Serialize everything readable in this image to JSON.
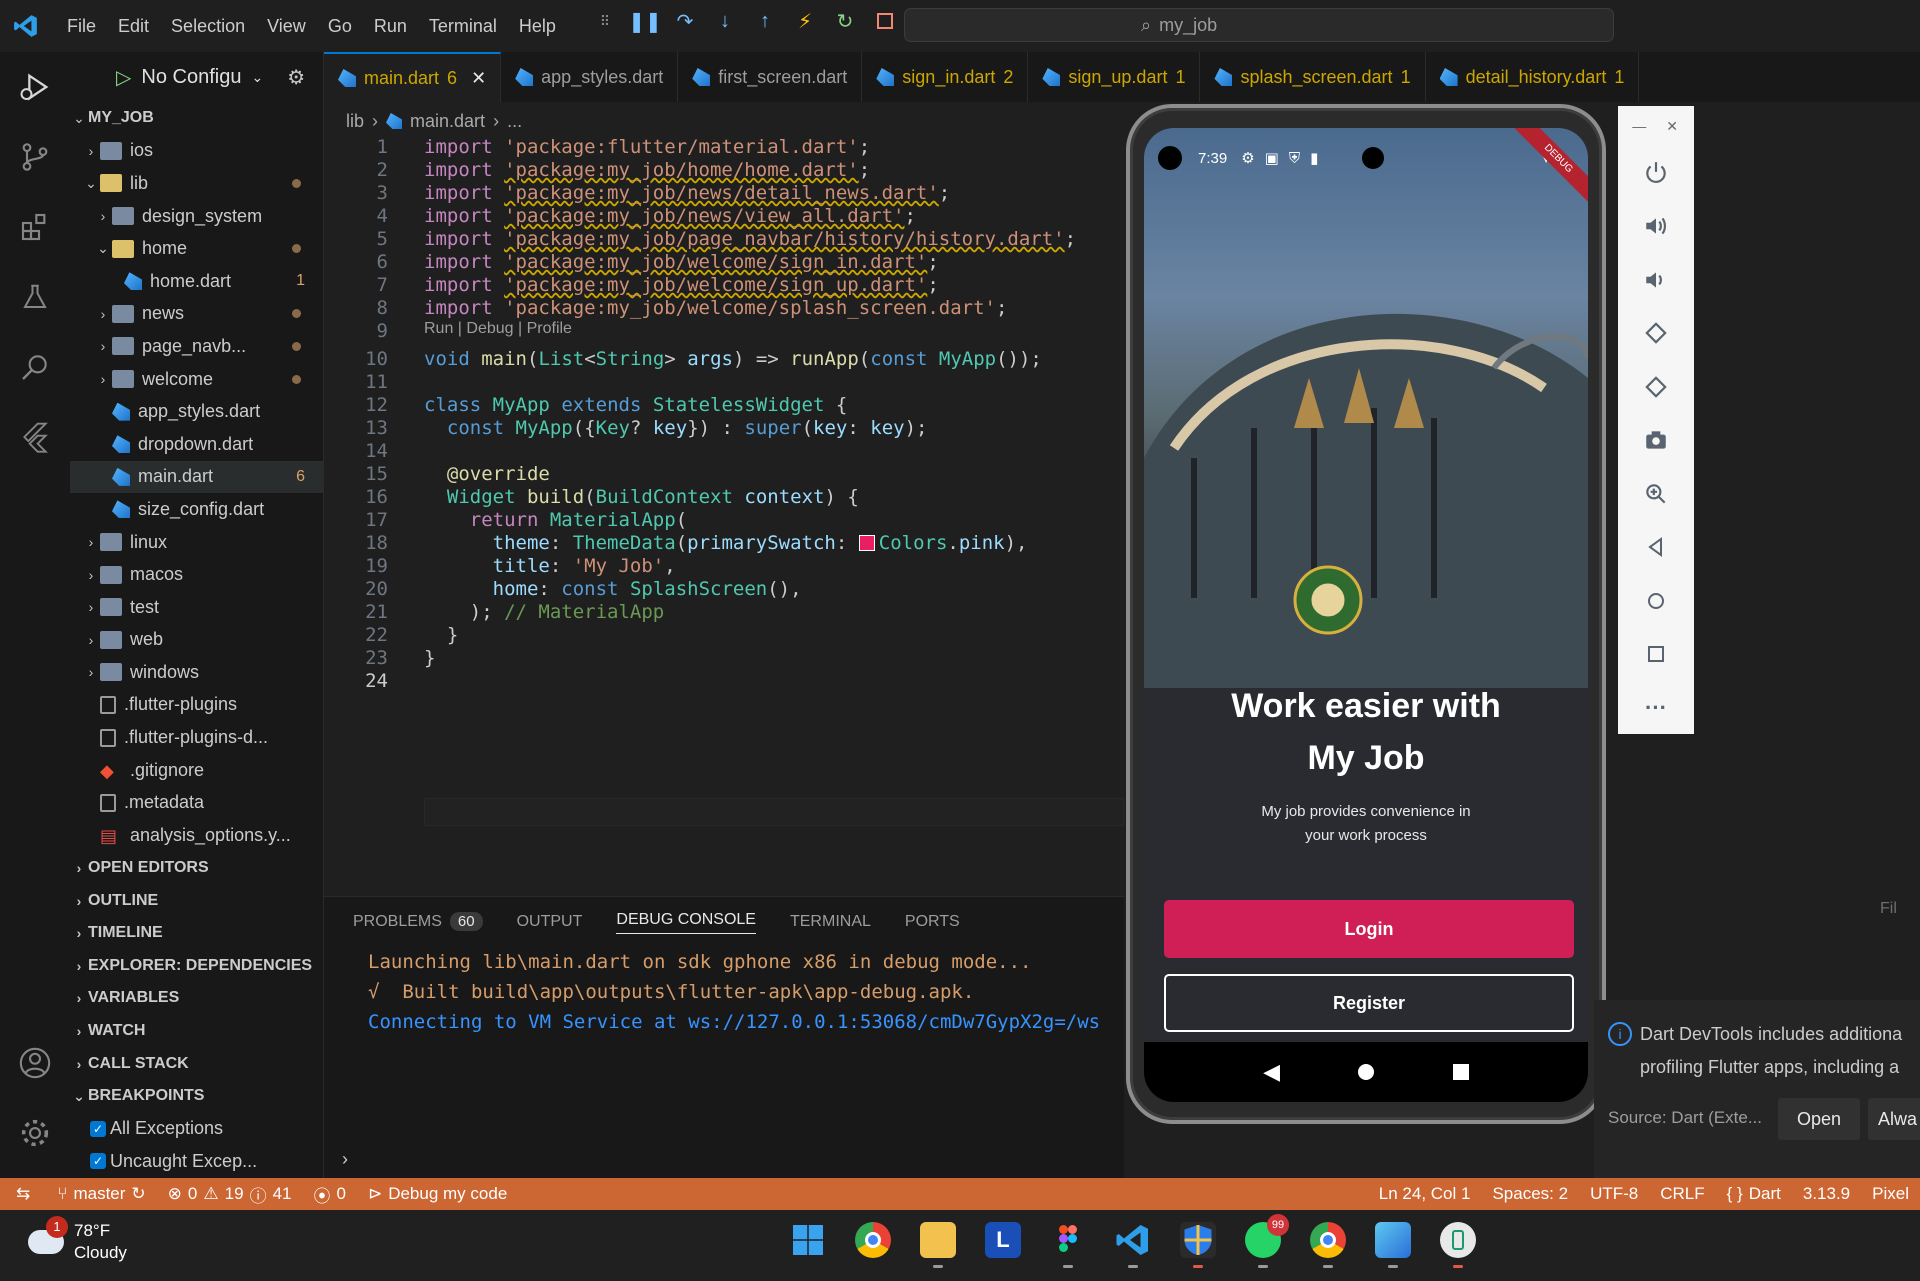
{
  "menu": [
    "File",
    "Edit",
    "Selection",
    "View",
    "Go",
    "Run",
    "Terminal",
    "Help"
  ],
  "search": {
    "text": "my_job"
  },
  "sidebar": {
    "run_config": "No Configu",
    "tree": [
      {
        "label": "MY_JOB",
        "depth": 0,
        "kind": "root",
        "chev": "v"
      },
      {
        "label": "ios",
        "depth": 1,
        "kind": "folder",
        "chev": ">"
      },
      {
        "label": "lib",
        "depth": 1,
        "kind": "folder-open",
        "chev": "v",
        "dot": true
      },
      {
        "label": "design_system",
        "depth": 2,
        "kind": "folder",
        "chev": ">"
      },
      {
        "label": "home",
        "depth": 2,
        "kind": "folder-open",
        "chev": "v",
        "dot": true
      },
      {
        "label": "home.dart",
        "depth": 3,
        "kind": "dart",
        "badge": "1"
      },
      {
        "label": "news",
        "depth": 2,
        "kind": "folder",
        "chev": ">",
        "dot": true
      },
      {
        "label": "page_navb...",
        "depth": 2,
        "kind": "folder",
        "chev": ">",
        "dot": true
      },
      {
        "label": "welcome",
        "depth": 2,
        "kind": "folder",
        "chev": ">",
        "dot": true
      },
      {
        "label": "app_styles.dart",
        "depth": 2,
        "kind": "dart"
      },
      {
        "label": "dropdown.dart",
        "depth": 2,
        "kind": "dart"
      },
      {
        "label": "main.dart",
        "depth": 2,
        "kind": "dart",
        "badge": "6",
        "selected": true
      },
      {
        "label": "size_config.dart",
        "depth": 2,
        "kind": "dart"
      },
      {
        "label": "linux",
        "depth": 1,
        "kind": "folder",
        "chev": ">"
      },
      {
        "label": "macos",
        "depth": 1,
        "kind": "folder",
        "chev": ">"
      },
      {
        "label": "test",
        "depth": 1,
        "kind": "folder",
        "chev": ">"
      },
      {
        "label": "web",
        "depth": 1,
        "kind": "folder",
        "chev": ">"
      },
      {
        "label": "windows",
        "depth": 1,
        "kind": "folder",
        "chev": ">"
      },
      {
        "label": ".flutter-plugins",
        "depth": 1,
        "kind": "file"
      },
      {
        "label": ".flutter-plugins-d...",
        "depth": 1,
        "kind": "file"
      },
      {
        "label": ".gitignore",
        "depth": 1,
        "kind": "git"
      },
      {
        "label": ".metadata",
        "depth": 1,
        "kind": "file"
      },
      {
        "label": "analysis_options.y...",
        "depth": 1,
        "kind": "yaml"
      }
    ],
    "sections": [
      "OPEN EDITORS",
      "OUTLINE",
      "TIMELINE",
      "EXPLORER: DEPENDENCIES",
      "VARIABLES",
      "WATCH",
      "CALL STACK",
      "BREAKPOINTS"
    ],
    "breakpoints": [
      "All Exceptions",
      "Uncaught Excep..."
    ]
  },
  "tabs": [
    {
      "label": "main.dart",
      "count": "6",
      "active": true
    },
    {
      "label": "app_styles.dart",
      "count": ""
    },
    {
      "label": "first_screen.dart",
      "count": ""
    },
    {
      "label": "sign_in.dart",
      "count": "2"
    },
    {
      "label": "sign_up.dart",
      "count": "1"
    },
    {
      "label": "splash_screen.dart",
      "count": "1"
    },
    {
      "label": "detail_history.dart",
      "count": "1"
    }
  ],
  "breadcrumb": [
    "lib",
    "main.dart",
    "..."
  ],
  "editor": {
    "codelens": "Run | Debug | Profile",
    "lines": [
      {
        "n": "1",
        "kw": "import",
        "s": "'package:flutter/material.dart'",
        "tail": ";",
        "warn": false
      },
      {
        "n": "2",
        "kw": "import",
        "s": "'package:my_job/home/home.dart'",
        "tail": ";",
        "warn": true
      },
      {
        "n": "3",
        "kw": "import",
        "s": "'package:my_job/news/detail_news.dart'",
        "tail": ";",
        "warn": true
      },
      {
        "n": "4",
        "kw": "import",
        "s": "'package:my_job/news/view_all.dart'",
        "tail": ";",
        "warn": true
      },
      {
        "n": "5",
        "kw": "import",
        "s": "'package:my_job/page_navbar/history/history.dart'",
        "tail": ";",
        "warn": true
      },
      {
        "n": "6",
        "kw": "import",
        "s": "'package:my_job/welcome/sign_in.dart'",
        "tail": ";",
        "warn": true
      },
      {
        "n": "7",
        "kw": "import",
        "s": "'package:my_job/welcome/sign_up.dart'",
        "tail": ";",
        "warn": true
      },
      {
        "n": "8",
        "kw": "import",
        "s": "'package:my_job/welcome/splash_screen.dart'",
        "tail": ";",
        "warn": false
      }
    ],
    "line_numbers": [
      "9",
      "10",
      "11",
      "12",
      "13",
      "14",
      "15",
      "16",
      "17",
      "18",
      "19",
      "20",
      "21",
      "22",
      "23",
      "24"
    ]
  },
  "panel": {
    "tabs": [
      "PROBLEMS",
      "OUTPUT",
      "DEBUG CONSOLE",
      "TERMINAL",
      "PORTS"
    ],
    "problems_count": "60",
    "output": [
      {
        "text": "Launching lib\\main.dart on sdk gphone x86 in debug mode...",
        "color": "#d69d6a"
      },
      {
        "text": "√  Built build\\app\\outputs\\flutter-apk\\app-debug.apk.",
        "color": "#d69d6a"
      },
      {
        "text": "Connecting to VM Service at ws://127.0.0.1:53068/cmDw7GypX2g=/ws",
        "color": "#3794ff"
      }
    ],
    "filter_hint": "Fil"
  },
  "phone": {
    "time": "7:39",
    "debug_ribbon": "DEBUG",
    "title_line1": "Work easier with",
    "title_line2": "My Job",
    "subtitle_line1": "My job provides convenience in",
    "subtitle_line2": "your work process",
    "login": "Login",
    "register": "Register",
    "accent": "#cf1f56"
  },
  "notification": {
    "line1": "Dart DevTools includes additiona",
    "line2": "profiling Flutter apps, including a",
    "source": "Source: Dart (Exte...",
    "open": "Open",
    "always": "Alwa"
  },
  "statusbar": {
    "branch": "master",
    "errors": "0",
    "warnings": "19",
    "infos": "41",
    "ports": "0",
    "debug": "Debug my code",
    "cursor": "Ln 24, Col 1",
    "spaces": "Spaces: 2",
    "encoding": "UTF-8",
    "eol": "CRLF",
    "language": "Dart",
    "version": "3.13.9",
    "device": "Pixel",
    "bg_color": "#cc6633"
  },
  "taskbar": {
    "temp": "78°F",
    "weather": "Cloudy",
    "weather_badge": "1",
    "whatsapp_badge": "99"
  }
}
